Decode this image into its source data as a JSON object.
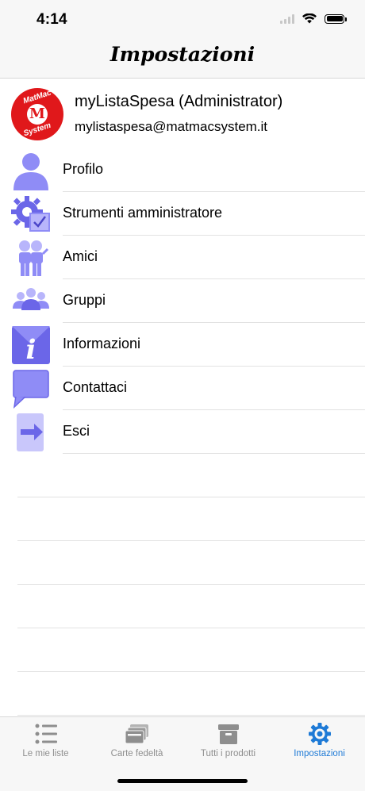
{
  "status_bar": {
    "time": "4:14"
  },
  "nav": {
    "title": "Impostazioni"
  },
  "account": {
    "logo_text_top": "MatMac",
    "logo_letter": "M",
    "logo_text_bottom": "System",
    "name": "myListaSpesa (Administrator)",
    "email": "mylistaspesa@matmacsystem.it"
  },
  "menu": [
    {
      "label": "Profilo",
      "icon": "profile-icon"
    },
    {
      "label": "Strumenti amministratore",
      "icon": "admin-tools-icon"
    },
    {
      "label": "Amici",
      "icon": "friends-icon"
    },
    {
      "label": "Gruppi",
      "icon": "groups-icon"
    },
    {
      "label": "Informazioni",
      "icon": "info-icon"
    },
    {
      "label": "Contattaci",
      "icon": "chat-bubble-icon"
    },
    {
      "label": "Esci",
      "icon": "logout-icon"
    }
  ],
  "tabs": [
    {
      "label": "Le mie liste",
      "icon": "list-icon",
      "active": false
    },
    {
      "label": "Carte fedeltà",
      "icon": "cards-icon",
      "active": false
    },
    {
      "label": "Tutti i prodotti",
      "icon": "archive-box-icon",
      "active": false
    },
    {
      "label": "Impostazioni",
      "icon": "gear-icon",
      "active": true
    }
  ],
  "colors": {
    "icon_purple": "#8f8cf6",
    "icon_purple_dark": "#6b66e8",
    "logo_red": "#e0181b",
    "tab_active": "#1e7ad6",
    "tab_inactive": "#8e8e8e"
  }
}
